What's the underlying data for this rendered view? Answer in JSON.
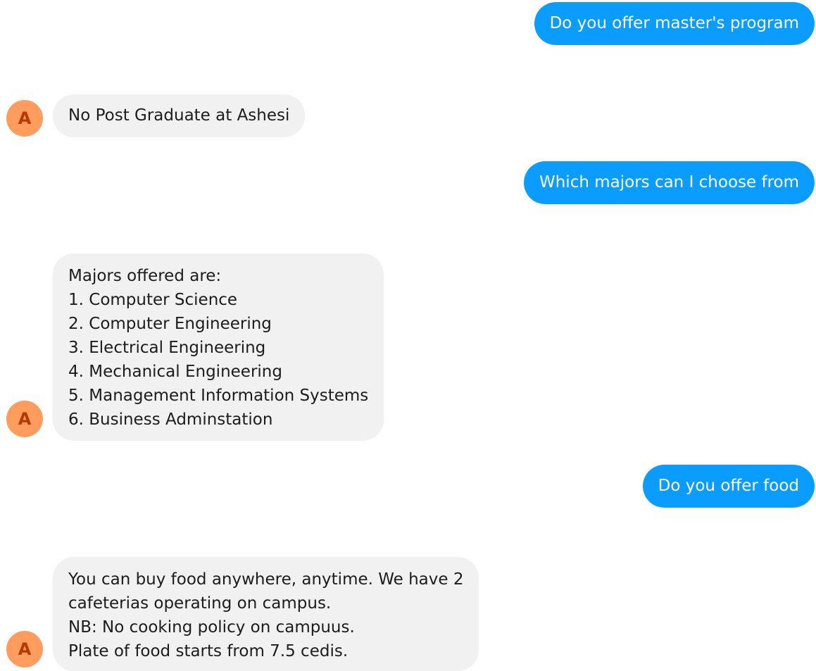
{
  "bot": {
    "avatar_letter": "A"
  },
  "messages": [
    {
      "sender": "user",
      "lines": [
        "Do you offer master's program"
      ]
    },
    {
      "sender": "bot",
      "lines": [
        "No Post Graduate at Ashesi"
      ]
    },
    {
      "sender": "user",
      "lines": [
        "Which majors can I choose from"
      ]
    },
    {
      "sender": "bot",
      "lines": [
        "Majors offered are:",
        "1. Computer Science",
        "2. Computer Engineering",
        "3. Electrical Engineering",
        "4. Mechanical Engineering",
        "5. Management Information Systems",
        "6. Business Adminstation"
      ]
    },
    {
      "sender": "user",
      "lines": [
        "Do you offer food"
      ]
    },
    {
      "sender": "bot",
      "lines": [
        "You can buy food anywhere, anytime. We have 2",
        "cafeterias operating on campus.",
        "NB: No cooking policy on campuus.",
        "Plate of food starts from 7.5 cedis."
      ]
    }
  ],
  "colors": {
    "user_bubble": "#0a9cff",
    "bot_bubble": "#f1f1f1",
    "avatar_bg": "#ff9c5e",
    "avatar_letter": "#b63a00"
  }
}
